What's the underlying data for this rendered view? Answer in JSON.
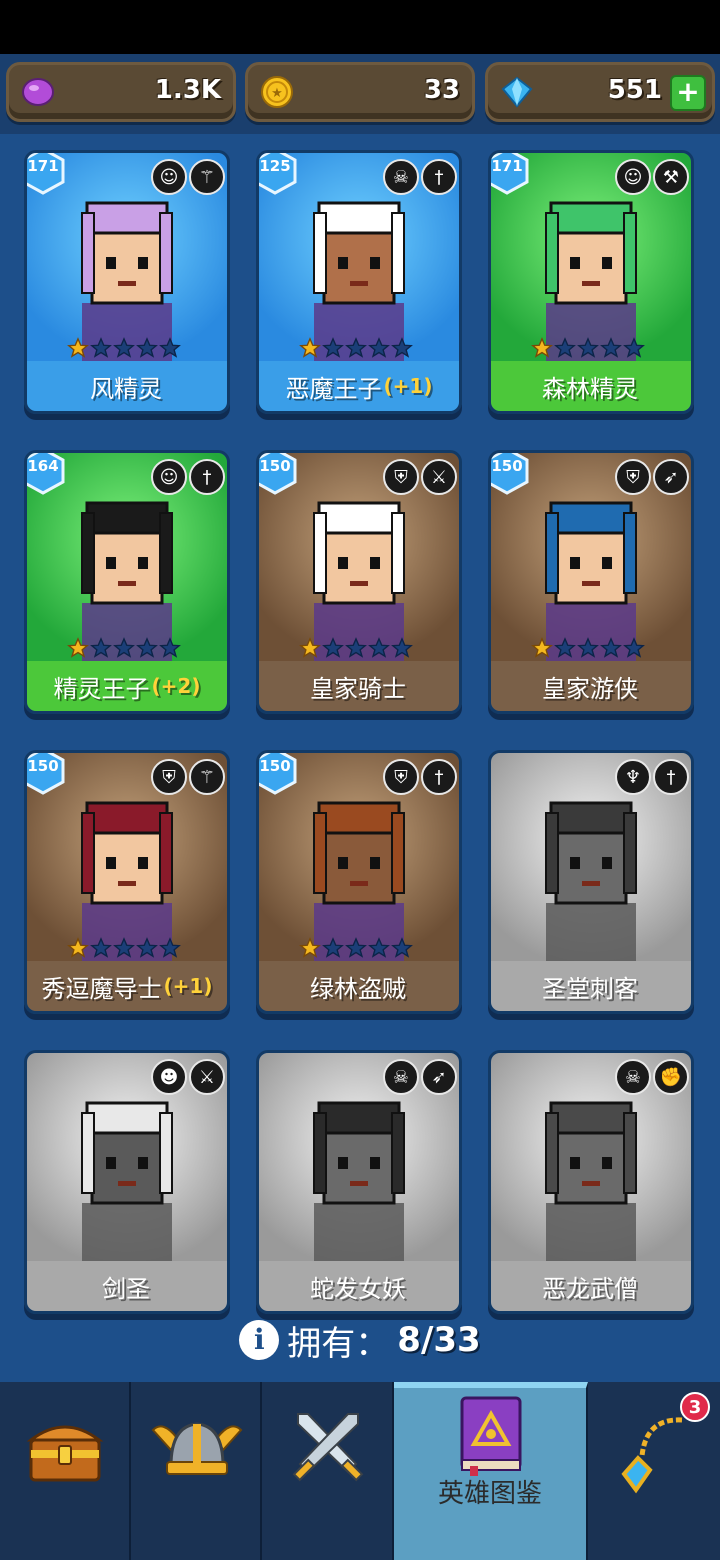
{
  "resources": {
    "elixir": {
      "value": "1.3K",
      "icon": "purple-elixir-icon"
    },
    "coins": {
      "value": "33",
      "icon": "gold-coin-icon"
    },
    "gems": {
      "value": "551",
      "icon": "blue-gem-icon"
    }
  },
  "heroes": [
    {
      "name": "风精灵",
      "bonus": "",
      "level": "171",
      "stars": 1,
      "theme": "blue",
      "owned": true,
      "badge1": "elf-head-icon",
      "badge2": "staff-icon"
    },
    {
      "name": "恶魔王子",
      "bonus": "(+1)",
      "level": "125",
      "stars": 1,
      "theme": "blue",
      "owned": true,
      "badge1": "demon-skull-icon",
      "badge2": "dagger-icon"
    },
    {
      "name": "森林精灵",
      "bonus": "",
      "level": "171",
      "stars": 1,
      "theme": "green",
      "owned": true,
      "badge1": "elf-head-icon",
      "badge2": "hammer-icon"
    },
    {
      "name": "精灵王子",
      "bonus": "(+2)",
      "level": "164",
      "stars": 1,
      "theme": "green",
      "owned": true,
      "badge1": "elf-head-icon",
      "badge2": "dagger-icon"
    },
    {
      "name": "皇家骑士",
      "bonus": "",
      "level": "150",
      "stars": 1,
      "theme": "brown",
      "owned": true,
      "badge1": "knight-helmet-icon",
      "badge2": "sword-icon"
    },
    {
      "name": "皇家游侠",
      "bonus": "",
      "level": "150",
      "stars": 1,
      "theme": "brown",
      "owned": true,
      "badge1": "knight-helmet-icon",
      "badge2": "bow-icon"
    },
    {
      "name": "秀逗魔导士",
      "bonus": "(+1)",
      "level": "150",
      "stars": 1,
      "theme": "brown",
      "owned": true,
      "badge1": "knight-helmet-icon",
      "badge2": "staff-icon"
    },
    {
      "name": "绿林盗贼",
      "bonus": "",
      "level": "150",
      "stars": 1,
      "theme": "brown",
      "owned": true,
      "badge1": "knight-helmet-icon",
      "badge2": "dagger-icon"
    },
    {
      "name": "圣堂刺客",
      "bonus": "",
      "level": "",
      "stars": 0,
      "theme": "gray",
      "owned": false,
      "badge1": "winged-emblem-icon",
      "badge2": "dagger-icon"
    },
    {
      "name": "剑圣",
      "bonus": "",
      "level": "",
      "stars": 0,
      "theme": "gray",
      "owned": false,
      "badge1": "orc-head-icon",
      "badge2": "sword-icon"
    },
    {
      "name": "蛇发女妖",
      "bonus": "",
      "level": "",
      "stars": 0,
      "theme": "gray",
      "owned": false,
      "badge1": "demon-skull-icon",
      "badge2": "bow-icon"
    },
    {
      "name": "恶龙武僧",
      "bonus": "",
      "level": "",
      "stars": 0,
      "theme": "gray",
      "owned": false,
      "badge1": "demon-skull-icon",
      "badge2": "fist-icon"
    }
  ],
  "owned": {
    "label": "拥有：",
    "count": "8/33"
  },
  "nav": {
    "tabs": [
      {
        "id": "chest",
        "icon": "treasure-chest-icon",
        "label": ""
      },
      {
        "id": "heroes",
        "icon": "viking-helmet-icon",
        "label": ""
      },
      {
        "id": "battle",
        "icon": "crossed-swords-icon",
        "label": ""
      },
      {
        "id": "codex",
        "icon": "hero-book-icon",
        "label": "英雄图鉴",
        "active": true
      },
      {
        "id": "amulet",
        "icon": "amulet-icon",
        "label": "",
        "notification": "3"
      }
    ]
  },
  "colors": {
    "background": "#1d4f8a",
    "active_tab": "#5c9fc2",
    "star_gold": "#f4b81e",
    "bonus_yellow": "#ffd23a"
  }
}
